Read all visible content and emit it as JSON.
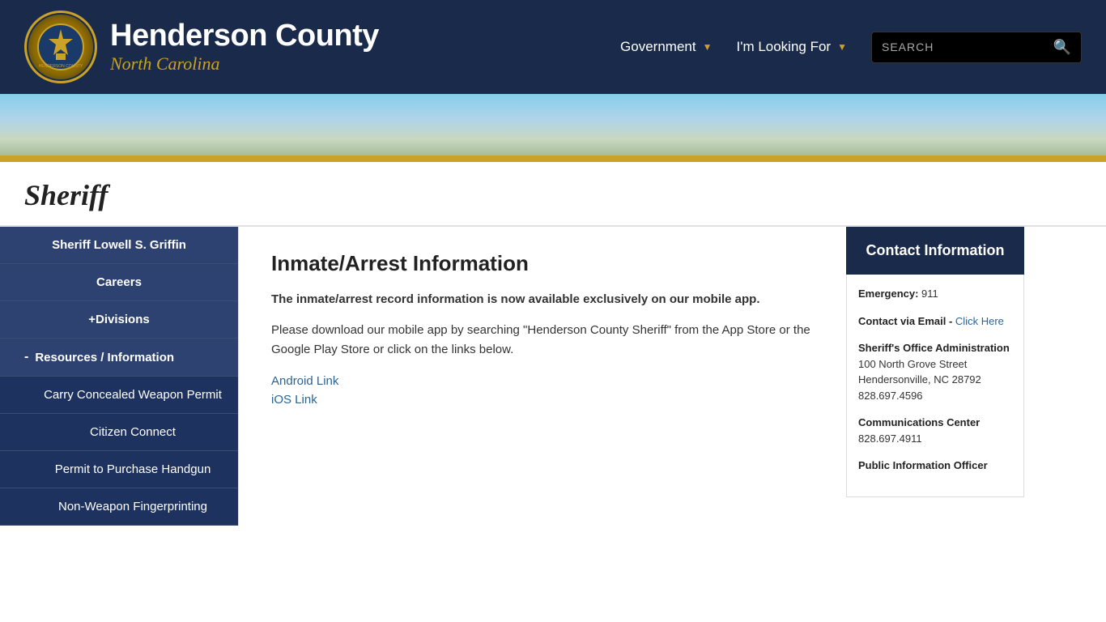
{
  "header": {
    "logo_title": "Henderson County",
    "logo_subtitle": "North Carolina",
    "nav": {
      "government_label": "Government",
      "looking_label": "I'm Looking For",
      "search_placeholder": "SEARCH"
    }
  },
  "page": {
    "title": "Sheriff"
  },
  "sidebar": {
    "items": [
      {
        "id": "sheriff-lowell",
        "label": "Sheriff Lowell S. Griffin",
        "level": "level1",
        "prefix": ""
      },
      {
        "id": "careers",
        "label": "Careers",
        "level": "level1",
        "prefix": ""
      },
      {
        "id": "divisions",
        "label": "Divisions",
        "level": "level1",
        "prefix": "+"
      },
      {
        "id": "resources",
        "label": "Resources / Information",
        "level": "level2",
        "prefix": "-"
      },
      {
        "id": "carry-concealed",
        "label": "Carry Concealed Weapon Permit",
        "level": "sub-item",
        "prefix": ""
      },
      {
        "id": "citizen-connect",
        "label": "Citizen Connect",
        "level": "sub-item",
        "prefix": ""
      },
      {
        "id": "permit-purchase",
        "label": "Permit to Purchase Handgun",
        "level": "sub-item",
        "prefix": ""
      },
      {
        "id": "non-weapon",
        "label": "Non-Weapon Fingerprinting",
        "level": "sub-item",
        "prefix": ""
      }
    ]
  },
  "main": {
    "title": "Inmate/Arrest Information",
    "bold_text": "The inmate/arrest record information is now available exclusively on our mobile app.",
    "body_text": "Please download our mobile app by searching \"Henderson County Sheriff\" from the App Store or the Google Play Store or click on the links below.",
    "android_link": "Android Link",
    "ios_link": "iOS Link"
  },
  "contact": {
    "header": "Contact Information",
    "emergency_label": "Emergency:",
    "emergency_value": "911",
    "email_label": "Contact via Email - ",
    "email_link_text": "Click Here",
    "office_label": "Sheriff's Office Administration",
    "office_address1": "100 North Grove Street",
    "office_address2": "Hendersonville, NC 28792",
    "office_phone": "828.697.4596",
    "comm_label": "Communications Center",
    "comm_phone": "828.697.4911",
    "pio_label": "Public Information Officer"
  }
}
